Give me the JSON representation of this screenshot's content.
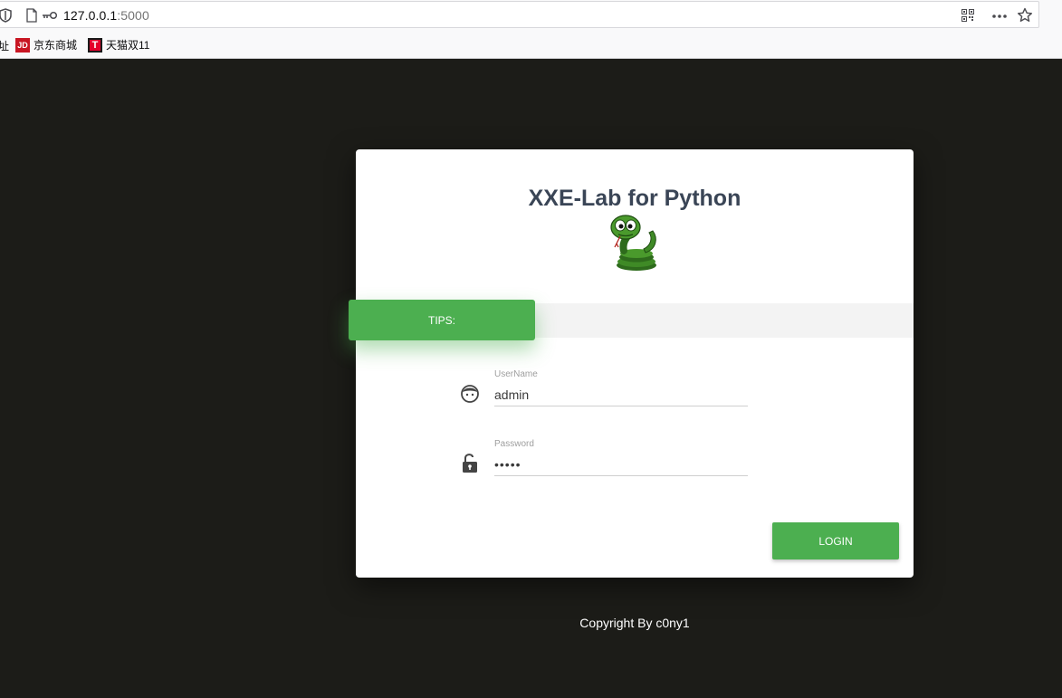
{
  "browser": {
    "url_host": "127.0.0.1",
    "url_port": ":5000",
    "bookmarks": [
      {
        "label": "址"
      },
      {
        "label": "京东商城",
        "logo": "JD",
        "color": "#c81623"
      },
      {
        "label": "天猫双11",
        "logo": "T",
        "color": "#e4002b"
      }
    ]
  },
  "login": {
    "title": "XXE-Lab for Python",
    "tips_label": "TIPS:",
    "username_label": "UserName",
    "username_value": "admin",
    "password_label": "Password",
    "password_value": "•••••",
    "login_label": "LOGIN",
    "accent": "#4caf50"
  },
  "footer": {
    "text": "Copyright By c0ny1"
  }
}
